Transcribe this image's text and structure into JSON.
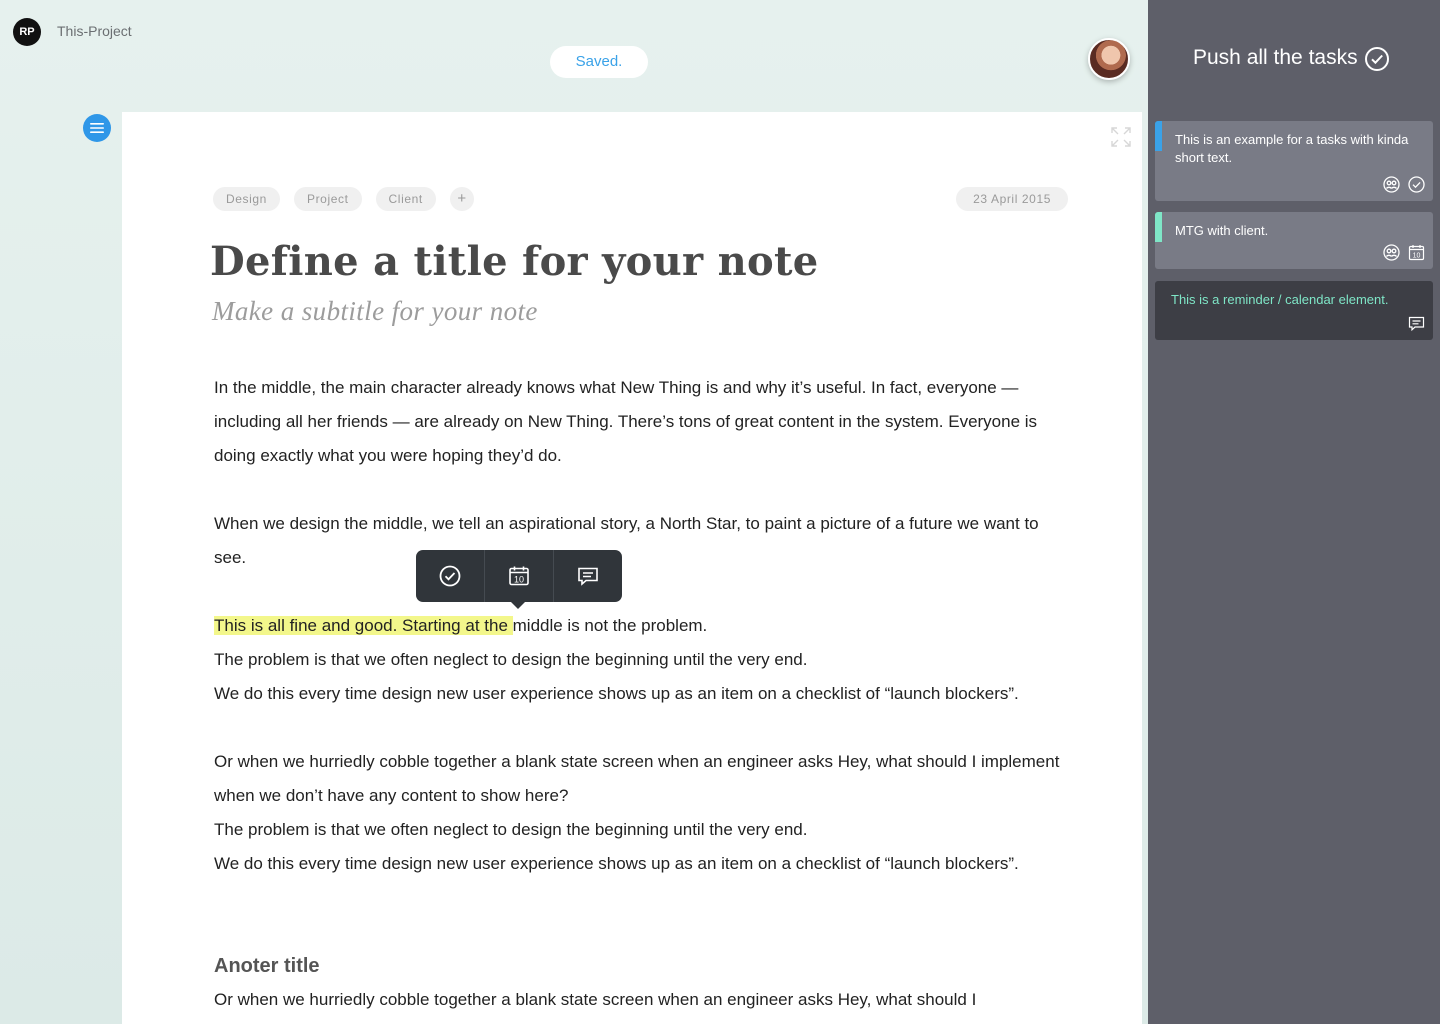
{
  "app": {
    "logo_text": "RP",
    "project_name": "This-Project",
    "save_status": "Saved."
  },
  "note": {
    "tags": [
      "Design",
      "Project",
      "Client"
    ],
    "add_tag_label": "+",
    "date": "23 April 2015",
    "title": "Define a title for your note",
    "subtitle": "Make a subtitle for your note",
    "paragraphs": [
      "In the middle, the main character already knows what New Thing is and why it’s useful. In fact, everyone — including all her friends — are already on New Thing. There’s tons of great content in the system. Everyone is doing exactly what you were hoping they’d do.",
      "When we design the middle, we tell an aspirational story, a North Star, to paint a picture of a future we want to see."
    ],
    "highlight_text": "This is all fine and good. Starting at the ",
    "highlight_rest": "middle is not the problem.",
    "lines_a": [
      "The problem is that we often neglect to design the beginning until the very end.",
      "We do this every time design new user experience shows up as an item on a checklist of “launch blockers”."
    ],
    "paragraph_or": "Or when we hurriedly cobble together a blank state screen when an engineer asks Hey, what should I implement when we don’t have any content to show here?",
    "lines_b": [
      "The problem is that we often neglect to design the beginning until the very end.",
      "We do this every time design new user experience shows up as an item on a checklist of “launch blockers”."
    ],
    "section_title": "Anoter title",
    "section_text": "Or when we hurriedly cobble together a blank state screen when an engineer asks Hey, what should I"
  },
  "toolbar": {
    "actions": [
      "check-circle-icon",
      "calendar-icon",
      "comment-icon"
    ],
    "calendar_day": "10"
  },
  "panel": {
    "title": "Push all the tasks",
    "tasks": [
      {
        "text": "This is an example for a tasks with kinda short text.",
        "stripe_color": "#3aa2e8",
        "icons": [
          "assignee-icon",
          "check-circle-icon"
        ]
      },
      {
        "text": "MTG with client.",
        "stripe_color": "#7fe6c7",
        "icons": [
          "assignee-icon",
          "calendar-icon"
        ],
        "calendar_day": "10"
      },
      {
        "text": "This is a reminder / calendar element.",
        "icons": [
          "comment-icon"
        ]
      }
    ]
  },
  "colors": {
    "accent": "#3aa2e8",
    "highlight": "#f3f78b",
    "panel_bg": "#5e5f69",
    "teal": "#7fe6c7"
  }
}
